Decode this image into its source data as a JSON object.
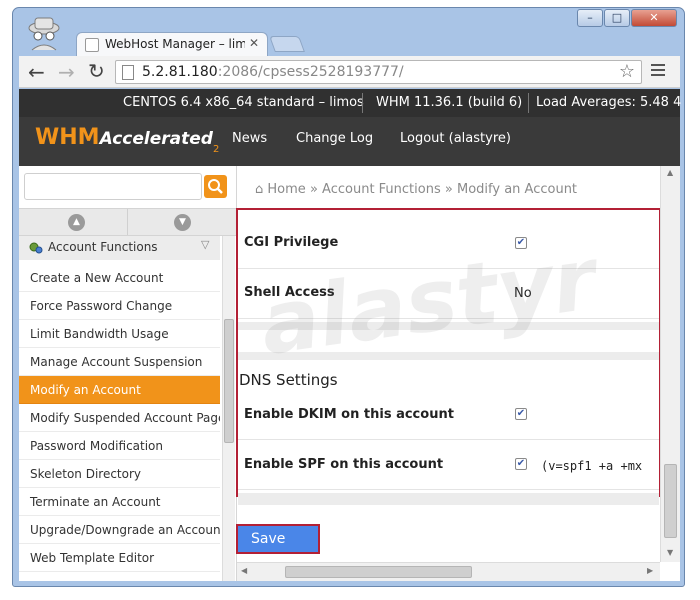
{
  "browser": {
    "tab_title": "WebHost Manager – limos",
    "url_host": "5.2.81.180",
    "url_rest": ":2086/cpsess2528193777/",
    "window_controls": {
      "minimize": "–",
      "maximize": "□",
      "close": "✕"
    }
  },
  "infobar": {
    "os": "CENTOS 6.4 x86_64 standard – limos",
    "whm_version": "WHM 11.36.1 (build 6)",
    "load": "Load Averages: 5.48 4"
  },
  "header": {
    "logo_whm": "WHM",
    "logo_accelerated": "Accelerated",
    "logo_sup": "2",
    "nav": [
      "News",
      "Change Log",
      "Logout (alastyre)"
    ]
  },
  "search": {
    "placeholder": ""
  },
  "breadcrumb": {
    "home": "Home",
    "sep": "»",
    "section": "Account Functions",
    "page": "Modify an Account"
  },
  "sidebar": {
    "section_title": "Account Functions",
    "items": [
      {
        "label": "Create a New Account"
      },
      {
        "label": "Force Password Change"
      },
      {
        "label": "Limit Bandwidth Usage"
      },
      {
        "label": "Manage Account Suspension"
      },
      {
        "label": "Modify an Account"
      },
      {
        "label": "Modify Suspended Account Page"
      },
      {
        "label": "Password Modification"
      },
      {
        "label": "Skeleton Directory"
      },
      {
        "label": "Terminate an Account"
      },
      {
        "label": "Upgrade/Downgrade an Account"
      },
      {
        "label": "Web Template Editor"
      }
    ]
  },
  "form": {
    "cgi_label": "CGI Privilege",
    "cgi_checked": true,
    "shell_label": "Shell Access",
    "shell_value": "No",
    "dns_heading": "DNS Settings",
    "dkim_label": "Enable DKIM on this account",
    "dkim_checked": true,
    "spf_label": "Enable SPF on this account",
    "spf_checked": true,
    "spf_record": "(v=spf1 +a +mx",
    "save_label": "Save"
  },
  "watermark": "alastyr",
  "colors": {
    "accent": "#f1931a",
    "header_bg": "#3a3a3a",
    "infobar_bg": "#303030",
    "highlight_border": "#b32035",
    "save_bg": "#4a86e8"
  }
}
